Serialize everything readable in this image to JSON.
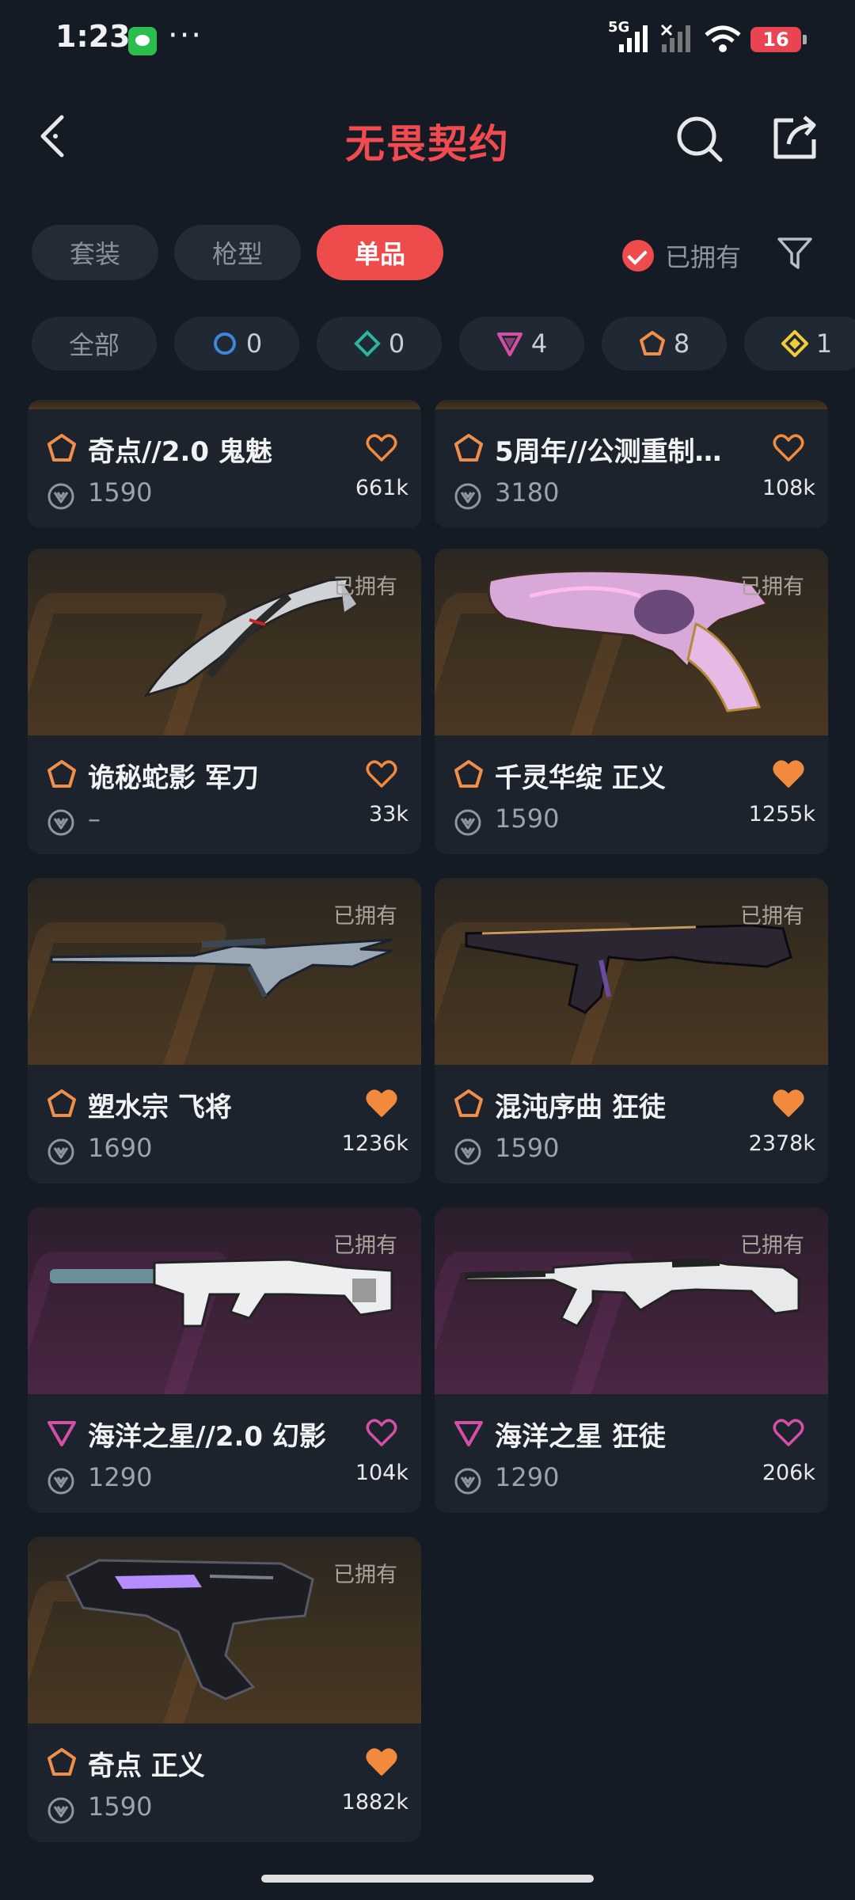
{
  "status_bar": {
    "time": "1:23",
    "network": "5G",
    "battery": "16"
  },
  "header": {
    "title": "无畏契约"
  },
  "tabs": [
    {
      "label": "套装",
      "active": false
    },
    {
      "label": "枪型",
      "active": false
    },
    {
      "label": "单品",
      "active": true
    }
  ],
  "owned_filter": {
    "label": "已拥有",
    "checked": true
  },
  "rarity_filters": [
    {
      "label": "全部"
    },
    {
      "icon": "select-tier-icon",
      "count": "0",
      "color": "#3e86d6"
    },
    {
      "icon": "deluxe-tier-icon",
      "count": "0",
      "color": "#2cb59d"
    },
    {
      "icon": "premium-tier-icon",
      "count": "4",
      "color": "#d64fa6"
    },
    {
      "icon": "exclusive-tier-icon",
      "count": "8",
      "color": "#f08f4a"
    },
    {
      "icon": "ultra-tier-icon",
      "count": "1",
      "color": "#f2cc3a"
    }
  ],
  "items": [
    {
      "name": "奇点//2.0 鬼魅",
      "price": "1590",
      "likes": "661k",
      "liked": false,
      "owned_label": "",
      "tier_color": "#f08f4a",
      "bg": "gold"
    },
    {
      "name": "5周年//公测重制…",
      "price": "3180",
      "likes": "108k",
      "liked": false,
      "owned_label": "",
      "tier_color": "#f08f4a",
      "bg": "gold"
    },
    {
      "name": "诡秘蛇影 军刀",
      "price": "–",
      "likes": "33k",
      "liked": false,
      "owned_label": "已拥有",
      "tier_color": "#f08f4a",
      "bg": "gold"
    },
    {
      "name": "千灵华绽 正义",
      "price": "1590",
      "likes": "1255k",
      "liked": true,
      "owned_label": "已拥有",
      "tier_color": "#f08f4a",
      "bg": "gold"
    },
    {
      "name": "塑水宗 飞将",
      "price": "1690",
      "likes": "1236k",
      "liked": true,
      "owned_label": "已拥有",
      "tier_color": "#f08f4a",
      "bg": "gold"
    },
    {
      "name": "混沌序曲 狂徒",
      "price": "1590",
      "likes": "2378k",
      "liked": true,
      "owned_label": "已拥有",
      "tier_color": "#f08f4a",
      "bg": "gold"
    },
    {
      "name": "海洋之星//2.0 幻影",
      "price": "1290",
      "likes": "104k",
      "liked": false,
      "owned_label": "已拥有",
      "tier_color": "#d64fa6",
      "bg": "purple"
    },
    {
      "name": "海洋之星 狂徒",
      "price": "1290",
      "likes": "206k",
      "liked": false,
      "owned_label": "已拥有",
      "tier_color": "#d64fa6",
      "bg": "purple"
    },
    {
      "name": "奇点 正义",
      "price": "1590",
      "likes": "1882k",
      "liked": true,
      "owned_label": "已拥有",
      "tier_color": "#f08f4a",
      "bg": "gold"
    }
  ],
  "colors": {
    "accent": "#ee4b4c",
    "heart": "#f28a3d",
    "heart_pink": "#d64fa6",
    "background": "#151b24",
    "card": "#1c232d"
  }
}
